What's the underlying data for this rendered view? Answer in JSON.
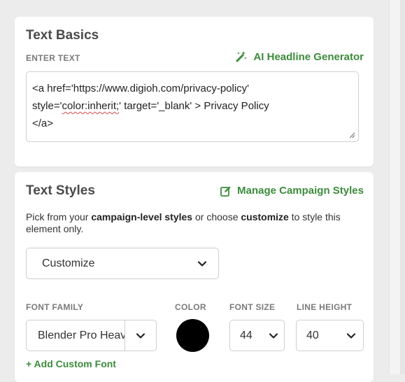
{
  "text_basics": {
    "title": "Text Basics",
    "enter_text_label": "ENTER TEXT",
    "ai_link": "AI Headline Generator",
    "content_line1": "<a href='https://www.digioh.com/privacy-policy'",
    "content_line2_pre": "style='",
    "content_line2_misspelled": "color:inherit;",
    "content_line2_post": "' target='_blank' > Privacy Policy",
    "content_line3": "</a>"
  },
  "text_styles": {
    "title": "Text Styles",
    "manage_link": "Manage Campaign Styles",
    "desc_pre": "Pick from your ",
    "desc_bold1": "campaign-level styles",
    "desc_mid": " or choose ",
    "desc_bold2": "customize",
    "desc_post": " to style this element only.",
    "style_select_value": "Customize",
    "font_family_label": "FONT FAMILY",
    "color_label": "COLOR",
    "font_size_label": "FONT SIZE",
    "line_height_label": "LINE HEIGHT",
    "font_family_value": "Blender Pro Heavy",
    "font_size_value": "44",
    "line_height_value": "40",
    "add_font_link": "+ Add Custom Font"
  },
  "colors": {
    "accent_green": "#3c8b3c",
    "swatch": "#000000"
  },
  "icons": {
    "ai": "magic-wand-icon",
    "manage": "edit-icon",
    "chevron": "chevron-down-icon",
    "resize": "resize-handle-icon"
  }
}
